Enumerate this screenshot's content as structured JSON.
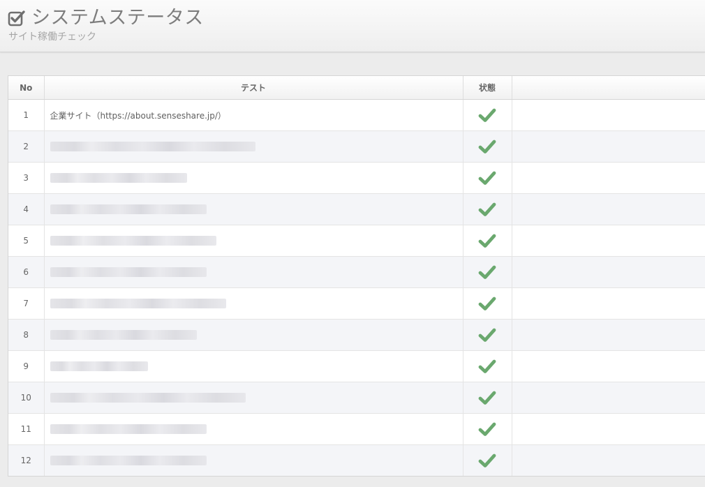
{
  "header": {
    "title": "システムステータス",
    "subtitle": "サイト稼働チェック",
    "title_icon": "checkbox-checked-icon"
  },
  "table": {
    "columns": {
      "no": "No",
      "test": "テスト",
      "status": "状態",
      "extra": ""
    },
    "rows": [
      {
        "no": "1",
        "test": "企業サイト（https://about.senseshare.jp/）",
        "status": "ok"
      },
      {
        "no": "2",
        "test": "",
        "status": "ok"
      },
      {
        "no": "3",
        "test": "",
        "status": "ok"
      },
      {
        "no": "4",
        "test": "",
        "status": "ok"
      },
      {
        "no": "5",
        "test": "",
        "status": "ok"
      },
      {
        "no": "6",
        "test": "",
        "status": "ok"
      },
      {
        "no": "7",
        "test": "",
        "status": "ok"
      },
      {
        "no": "8",
        "test": "",
        "status": "ok"
      },
      {
        "no": "9",
        "test": "",
        "status": "ok"
      },
      {
        "no": "10",
        "test": "",
        "status": "ok"
      },
      {
        "no": "11",
        "test": "",
        "status": "ok"
      },
      {
        "no": "12",
        "test": "",
        "status": "ok"
      }
    ]
  },
  "colors": {
    "check_green": "#6aa86e",
    "title_gray": "#7d7d7d"
  }
}
